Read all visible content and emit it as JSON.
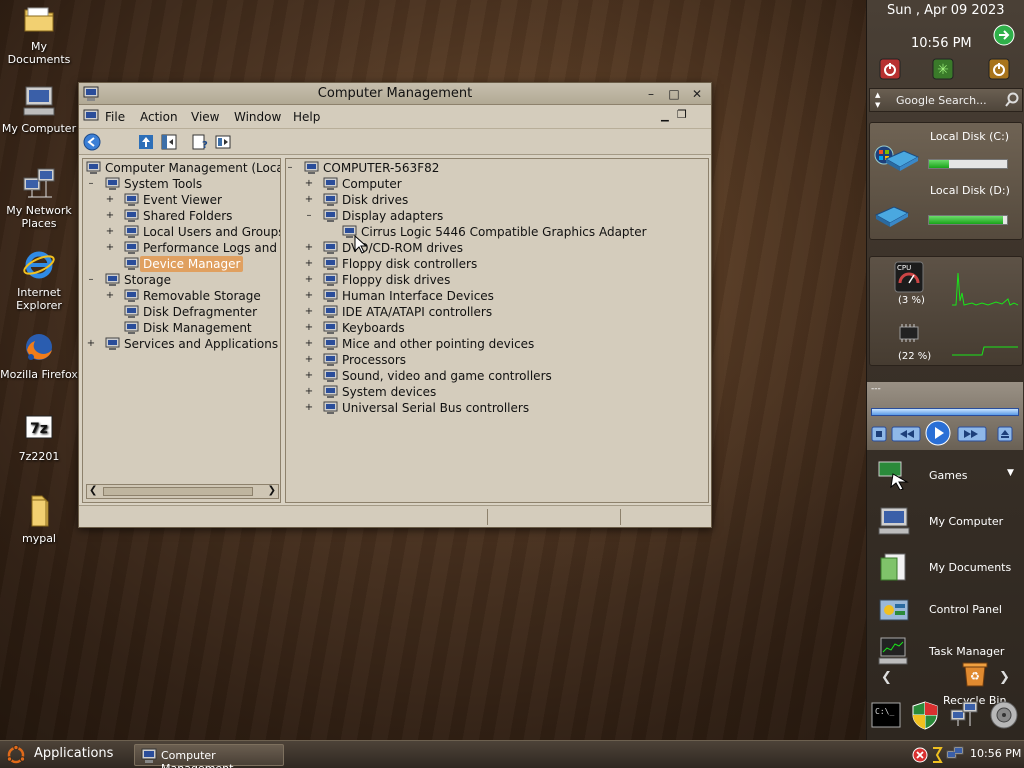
{
  "desktop": {
    "icons": [
      {
        "label": "My Documents"
      },
      {
        "label": "My Computer"
      },
      {
        "label": "My Network Places"
      },
      {
        "label": "Internet Explorer"
      },
      {
        "label": "Mozilla Firefox"
      },
      {
        "label": "7z2201"
      },
      {
        "label": "mypal"
      }
    ]
  },
  "window": {
    "title": "Computer Management",
    "controls": {
      "minimize": "–",
      "maximize": "□",
      "close": "✕"
    },
    "menu": [
      "File",
      "Action",
      "View",
      "Window",
      "Help"
    ],
    "left_tree": [
      {
        "label": "Computer Management (Local",
        "expander": "",
        "level": 0
      },
      {
        "label": "System Tools",
        "expander": "–",
        "level": 1
      },
      {
        "label": "Event Viewer",
        "expander": "+",
        "level": 2
      },
      {
        "label": "Shared Folders",
        "expander": "+",
        "level": 2
      },
      {
        "label": "Local Users and Groups",
        "expander": "+",
        "level": 2
      },
      {
        "label": "Performance Logs and A",
        "expander": "+",
        "level": 2
      },
      {
        "label": "Device Manager",
        "expander": "",
        "level": 2,
        "selected": true
      },
      {
        "label": "Storage",
        "expander": "–",
        "level": 1
      },
      {
        "label": "Removable Storage",
        "expander": "+",
        "level": 2
      },
      {
        "label": "Disk Defragmenter",
        "expander": "",
        "level": 2
      },
      {
        "label": "Disk Management",
        "expander": "",
        "level": 2
      },
      {
        "label": "Services and Applications",
        "expander": "+",
        "level": 1
      }
    ],
    "right_tree": [
      {
        "label": "COMPUTER-563F82",
        "expander": "–",
        "level": 0
      },
      {
        "label": "Computer",
        "expander": "+",
        "level": 1
      },
      {
        "label": "Disk drives",
        "expander": "+",
        "level": 1
      },
      {
        "label": "Display adapters",
        "expander": "–",
        "level": 1
      },
      {
        "label": "Cirrus Logic 5446 Compatible Graphics Adapter",
        "expander": "",
        "level": 2
      },
      {
        "label": "DVD/CD-ROM drives",
        "expander": "+",
        "level": 1
      },
      {
        "label": "Floppy disk controllers",
        "expander": "+",
        "level": 1
      },
      {
        "label": "Floppy disk drives",
        "expander": "+",
        "level": 1
      },
      {
        "label": "Human Interface Devices",
        "expander": "+",
        "level": 1
      },
      {
        "label": "IDE ATA/ATAPI controllers",
        "expander": "+",
        "level": 1
      },
      {
        "label": "Keyboards",
        "expander": "+",
        "level": 1
      },
      {
        "label": "Mice and other pointing devices",
        "expander": "+",
        "level": 1
      },
      {
        "label": "Processors",
        "expander": "+",
        "level": 1
      },
      {
        "label": "Sound, video and game controllers",
        "expander": "+",
        "level": 1
      },
      {
        "label": "System devices",
        "expander": "+",
        "level": 1
      },
      {
        "label": "Universal Serial Bus controllers",
        "expander": "+",
        "level": 1
      }
    ]
  },
  "sidebar": {
    "date": "Sun , Apr 09 2023",
    "time": "10:56 PM",
    "search_placeholder": "Google Search...",
    "disks": [
      {
        "label": "Local Disk (C:)",
        "used_fraction": 0.25
      },
      {
        "label": "Local Disk (D:)",
        "used_fraction": 0.95
      }
    ],
    "cpu": {
      "label": "CPU",
      "value": "(3 %)"
    },
    "memory": {
      "value": "(22 %)"
    },
    "media_title": "---",
    "links": [
      {
        "label": "Games"
      },
      {
        "label": "My Computer"
      },
      {
        "label": "My Documents"
      },
      {
        "label": "Control Panel"
      },
      {
        "label": "Task Manager"
      },
      {
        "label": "Recycle Bin"
      }
    ]
  },
  "taskbar": {
    "start_label": "Applications",
    "tasks": [
      {
        "label": "Computer Management"
      }
    ],
    "clock": "10:56 PM"
  },
  "colors": {
    "selection": "#e0a060",
    "window_bg": "#d4ccbc",
    "accent_green": "#19a319"
  }
}
